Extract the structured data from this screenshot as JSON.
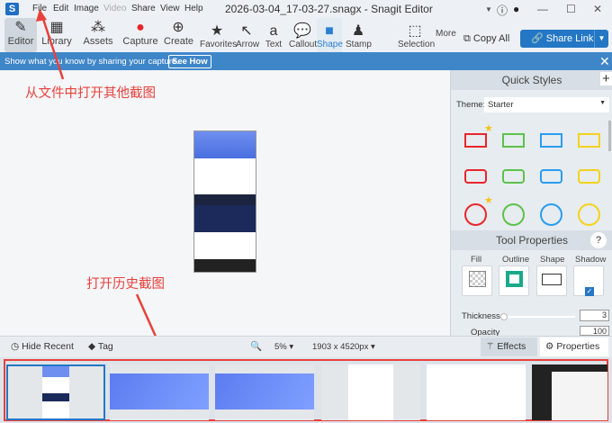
{
  "titlebar": {
    "title": "2026-03-04_17-03-27.snagx - Snagit Editor",
    "logo": "S",
    "menus": [
      "File",
      "Edit",
      "Image",
      "Video",
      "Share",
      "View",
      "Help"
    ]
  },
  "toolbar": {
    "tabs": [
      "Editor",
      "Library",
      "Assets",
      "Capture",
      "Create"
    ],
    "tools": [
      "Favorites",
      "Arrow",
      "Text",
      "Callout",
      "Shape",
      "Stamp",
      "Selection"
    ],
    "more": "More",
    "copy_all": "Copy All",
    "share_link": "Share Link",
    "active_tool": "Shape"
  },
  "banner": {
    "text": "Show what you know by sharing your capture.",
    "button": "See How"
  },
  "quick_styles": {
    "title": "Quick Styles",
    "theme_label": "Theme:",
    "theme_value": "Starter",
    "colors": [
      "#e8262b",
      "#5cc24a",
      "#2a9cf0",
      "#f4d21c"
    ]
  },
  "tool_properties": {
    "title": "Tool Properties",
    "fill": "Fill",
    "outline": "Outline",
    "shape": "Shape",
    "shadow": "Shadow",
    "thickness_label": "Thickness",
    "thickness": "3",
    "opacity_label": "Opacity",
    "opacity": "100",
    "outline_color": "#1aa98a"
  },
  "bottom": {
    "hide_recent": "Hide Recent",
    "tag": "Tag",
    "zoom": "5%",
    "dimensions": "1903 x 4520px",
    "effects": "Effects",
    "properties": "Properties"
  },
  "annotations": {
    "file_note": "从文件中打开其他截图",
    "history_note": "打开历史截图"
  }
}
